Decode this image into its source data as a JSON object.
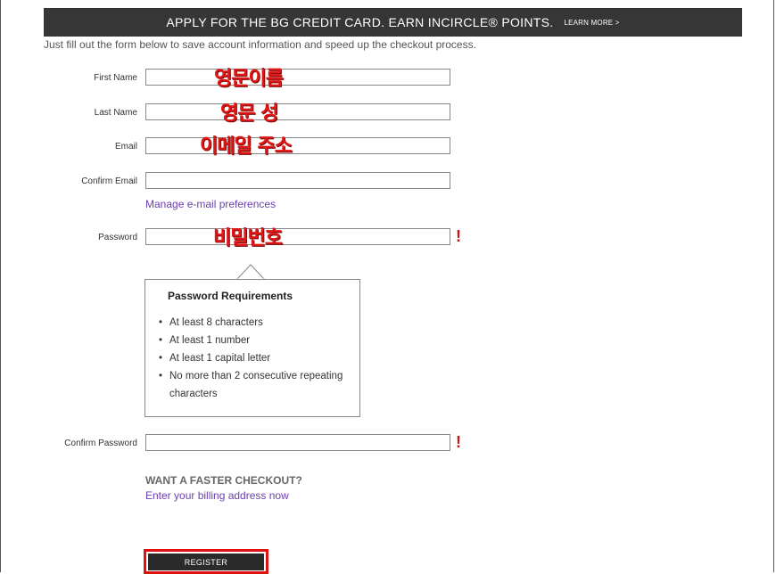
{
  "banner": {
    "text": "APPLY FOR THE BG CREDIT CARD. EARN INCIRCLE® POINTS.",
    "learn_more": "LEARN MORE >"
  },
  "intro": "Just fill out the form below to save account information and speed up the checkout process.",
  "form": {
    "first_name_label": "First Name",
    "last_name_label": "Last Name",
    "email_label": "Email",
    "confirm_email_label": "Confirm Email",
    "password_label": "Password",
    "confirm_password_label": "Confirm Password",
    "manage_email_link": "Manage e-mail preferences",
    "error_mark": "!"
  },
  "annotations": {
    "first_name": "영문이름",
    "last_name": "영문 성",
    "email": "이메일 주소",
    "password": "비밀번호"
  },
  "password_requirements": {
    "title": "Password Requirements",
    "items": [
      "At least 8 characters",
      "At least 1 number",
      "At least 1 capital letter",
      "No more than 2 consecutive repeating characters"
    ]
  },
  "faster_checkout": {
    "title": "WANT A FASTER CHECKOUT?",
    "link": "Enter your billing address now"
  },
  "register_button": "REGISTER"
}
